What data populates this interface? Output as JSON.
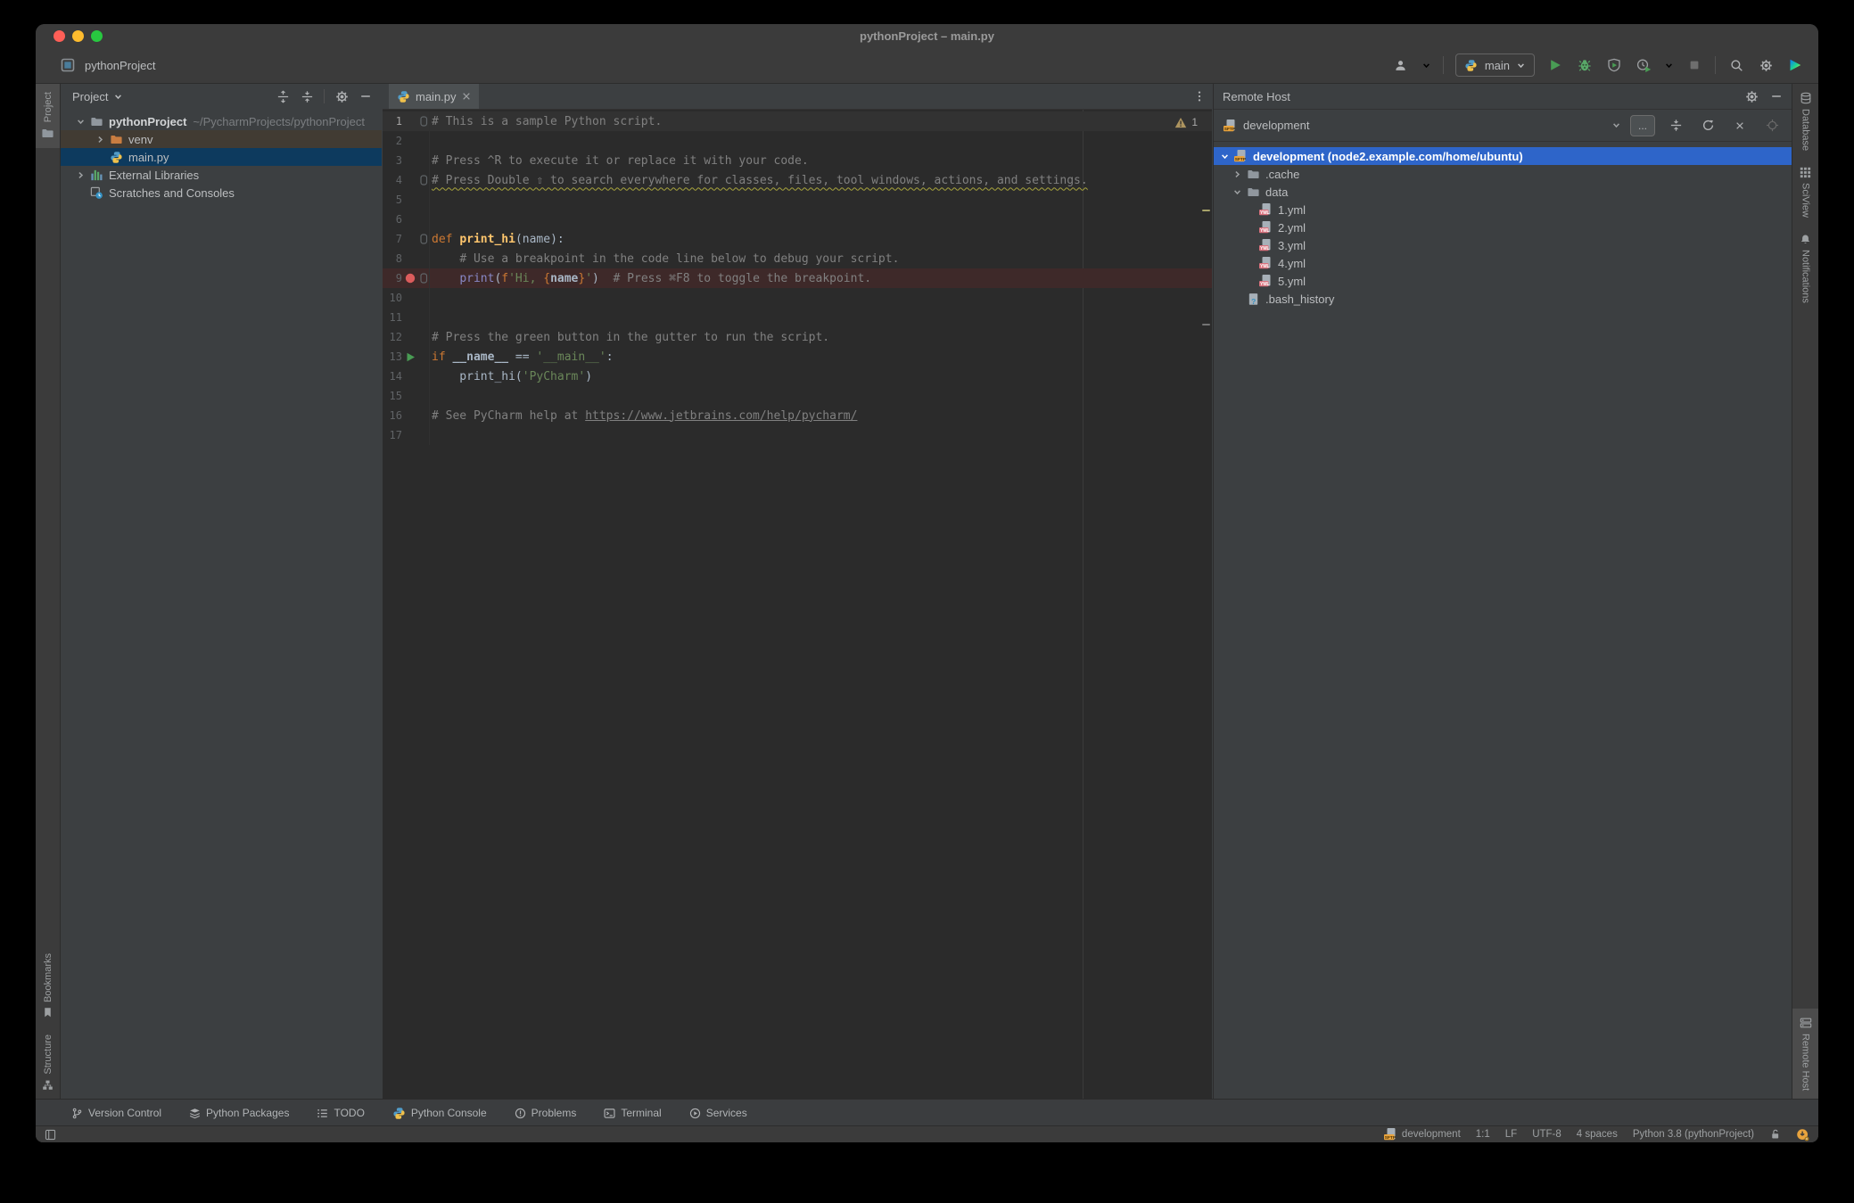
{
  "window_title": "pythonProject – main.py",
  "toolbar": {
    "project_name": "pythonProject",
    "run_config": "main"
  },
  "left_stripe": {
    "top": [
      {
        "label": "Project",
        "icon": "folder",
        "active": true
      }
    ],
    "bottom": [
      {
        "label": "Bookmarks",
        "icon": "bookmark"
      },
      {
        "label": "Structure",
        "icon": "structure"
      }
    ]
  },
  "right_stripe": {
    "top": [
      {
        "label": "Database",
        "icon": "database"
      },
      {
        "label": "SciView",
        "icon": "grid"
      },
      {
        "label": "Notifications",
        "icon": "bell"
      }
    ],
    "bottom": [
      {
        "label": "Remote Host",
        "icon": "server",
        "active": true
      }
    ]
  },
  "project": {
    "title": "Project",
    "rows": [
      {
        "level": 0,
        "chevron": "down",
        "icon": "folder",
        "name": "pythonProject",
        "hint": "~/PycharmProjects/pythonProject",
        "bold": true
      },
      {
        "level": 1,
        "chevron": "right",
        "icon": "folderorange",
        "name": "venv",
        "state": "hoverrow"
      },
      {
        "level": 1,
        "chevron": null,
        "icon": "pyfile",
        "name": "main.py",
        "state": "selected-dim"
      },
      {
        "level": 0,
        "chevron": "right",
        "icon": "libs",
        "name": "External Libraries"
      },
      {
        "level": 0,
        "chevron": null,
        "icon": "scratch",
        "name": "Scratches and Consoles"
      }
    ]
  },
  "editor": {
    "tab": "main.py",
    "warning_count": "1",
    "lines": [
      {
        "n": 1,
        "current": true,
        "fold": true,
        "tokens": [
          [
            "cmt",
            "# This is a sample Python script."
          ]
        ]
      },
      {
        "n": 2,
        "tokens": []
      },
      {
        "n": 3,
        "tokens": [
          [
            "cmt",
            "# Press ^R to execute it or replace it with your code."
          ]
        ]
      },
      {
        "n": 4,
        "fold": true,
        "tokens": [
          [
            "typo",
            "# Press Double ⇧ to search everywhere for classes, files, tool windows, actions, and settings."
          ]
        ]
      },
      {
        "n": 5,
        "tokens": []
      },
      {
        "n": 6,
        "tokens": []
      },
      {
        "n": 7,
        "fold": true,
        "tokens": [
          [
            "kw",
            "def "
          ],
          [
            "fn",
            "print_hi"
          ],
          [
            "plain",
            "(name):"
          ]
        ]
      },
      {
        "n": 8,
        "tokens": [
          [
            "plain",
            "    "
          ],
          [
            "cmt",
            "# Use a breakpoint in the code line below to debug your script."
          ]
        ]
      },
      {
        "n": 9,
        "breakpoint": true,
        "bp": true,
        "fold": true,
        "tokens": [
          [
            "plain",
            "    "
          ],
          [
            "builtin",
            "print"
          ],
          [
            "plain",
            "("
          ],
          [
            "kw",
            "f"
          ],
          [
            "str",
            "'Hi, "
          ],
          [
            "brace",
            "{"
          ],
          [
            "plainb",
            "name"
          ],
          [
            "brace",
            "}"
          ],
          [
            "str",
            "'"
          ],
          [
            "plain",
            ")  "
          ],
          [
            "cmt",
            "# Press ⌘F8 to toggle the breakpoint."
          ]
        ]
      },
      {
        "n": 10,
        "tokens": []
      },
      {
        "n": 11,
        "tokens": []
      },
      {
        "n": 12,
        "tokens": [
          [
            "cmt",
            "# Press the green button in the gutter to run the script."
          ]
        ]
      },
      {
        "n": 13,
        "run": true,
        "tokens": [
          [
            "kw",
            "if "
          ],
          [
            "plainb",
            "__name__"
          ],
          [
            "plain",
            " == "
          ],
          [
            "str",
            "'__main__'"
          ],
          [
            "plain",
            ":"
          ]
        ]
      },
      {
        "n": 14,
        "tokens": [
          [
            "plain",
            "    print_hi("
          ],
          [
            "str",
            "'PyCharm'"
          ],
          [
            "plain",
            ")"
          ]
        ]
      },
      {
        "n": 15,
        "tokens": []
      },
      {
        "n": 16,
        "tokens": [
          [
            "cmt",
            "# See PyCharm help at "
          ],
          [
            "link",
            "https://www.jetbrains.com/help/pycharm/"
          ]
        ]
      },
      {
        "n": 17,
        "tokens": []
      }
    ]
  },
  "remote": {
    "title": "Remote Host",
    "server_combo": "development",
    "browse_button": "...",
    "rows": [
      {
        "level": 0,
        "chevron": "down",
        "icon": "sftp",
        "name": "development (node2.example.com/home/ubuntu)",
        "state": "selected",
        "bold": true
      },
      {
        "level": 1,
        "chevron": "right",
        "icon": "folder",
        "name": ".cache"
      },
      {
        "level": 1,
        "chevron": "down",
        "icon": "folder",
        "name": "data"
      },
      {
        "level": 2,
        "chevron": null,
        "icon": "yml",
        "name": "1.yml"
      },
      {
        "level": 2,
        "chevron": null,
        "icon": "yml",
        "name": "2.yml"
      },
      {
        "level": 2,
        "chevron": null,
        "icon": "yml",
        "name": "3.yml"
      },
      {
        "level": 2,
        "chevron": null,
        "icon": "yml",
        "name": "4.yml"
      },
      {
        "level": 2,
        "chevron": null,
        "icon": "yml",
        "name": "5.yml"
      },
      {
        "level": 1,
        "chevron": null,
        "icon": "fileq",
        "name": ".bash_history"
      }
    ]
  },
  "bottom_bar": [
    {
      "label": "Version Control",
      "icon": "branch"
    },
    {
      "label": "Python Packages",
      "icon": "stack"
    },
    {
      "label": "TODO",
      "icon": "todo"
    },
    {
      "label": "Python Console",
      "icon": "pyfile"
    },
    {
      "label": "Problems",
      "icon": "problem"
    },
    {
      "label": "Terminal",
      "icon": "terminal"
    },
    {
      "label": "Services",
      "icon": "services"
    }
  ],
  "status_bar": {
    "host": "development",
    "caret": "1:1",
    "line_ending": "LF",
    "encoding": "UTF-8",
    "indent": "4 spaces",
    "interpreter": "Python 3.8 (pythonProject)"
  }
}
